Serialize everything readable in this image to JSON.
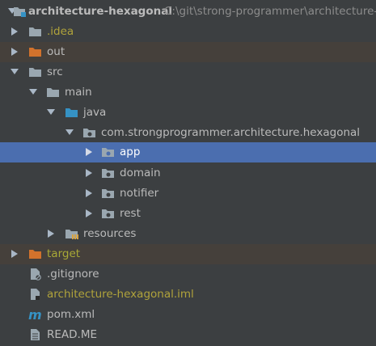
{
  "project_view": {
    "root": {
      "name": "architecture-hexagonal",
      "path": "C:\\git\\strong-programmer\\architecture-"
    },
    "items": [
      {
        "label": ".idea"
      },
      {
        "label": "out"
      },
      {
        "label": "src"
      },
      {
        "label": "main"
      },
      {
        "label": "java"
      },
      {
        "label": "com.strongprogrammer.architecture.hexagonal"
      },
      {
        "label": "app"
      },
      {
        "label": "domain"
      },
      {
        "label": "notifier"
      },
      {
        "label": "rest"
      },
      {
        "label": "resources"
      },
      {
        "label": "target"
      },
      {
        "label": ".gitignore"
      },
      {
        "label": "architecture-hexagonal.iml"
      },
      {
        "label": "pom.xml"
      },
      {
        "label": "READ.ME"
      }
    ]
  },
  "colors": {
    "background": "#3c3f41",
    "selection": "#4b6eaf",
    "excluded_row": "#45403b",
    "folder_gray": "#9aa7b0",
    "folder_orange": "#d2722c",
    "source_blue": "#3592c4",
    "ignored_text": "#b0a33b"
  }
}
